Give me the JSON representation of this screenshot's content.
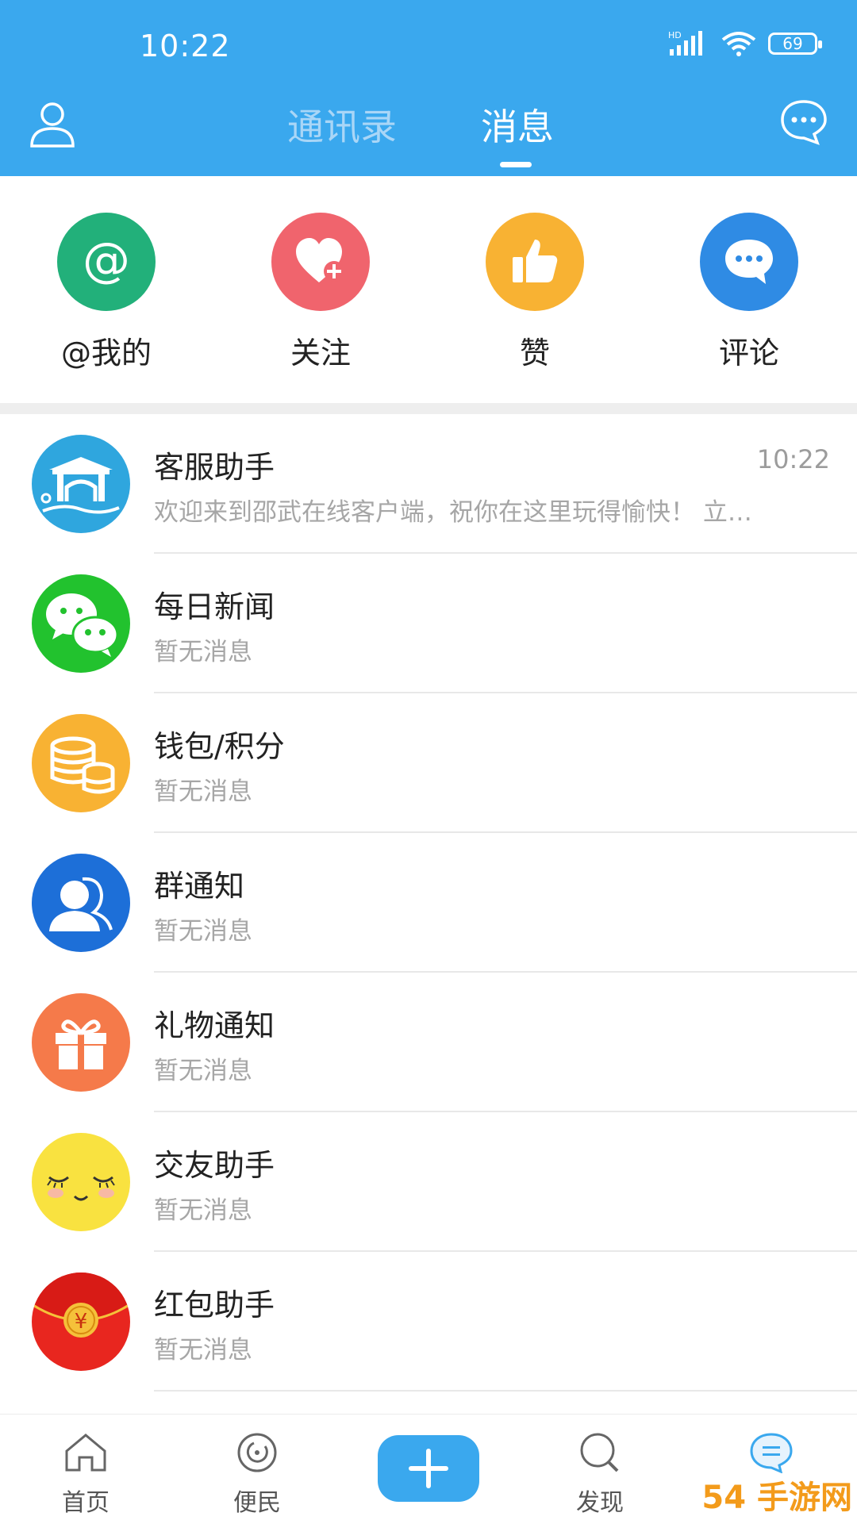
{
  "status": {
    "time": "10:22",
    "signal_tag": "HD",
    "battery": "69"
  },
  "header": {
    "tabs": [
      "通讯录",
      "消息"
    ]
  },
  "quick_actions": [
    {
      "label": "@我的",
      "icon": "at-icon",
      "color": "#22b07a"
    },
    {
      "label": "关注",
      "icon": "heart-plus-icon",
      "color": "#f0646d"
    },
    {
      "label": "赞",
      "icon": "thumbs-up-icon",
      "color": "#f8b233"
    },
    {
      "label": "评论",
      "icon": "comment-icon",
      "color": "#2f8be4"
    }
  ],
  "messages": [
    {
      "title": "客服助手",
      "preview": "欢迎来到邵武在线客户端，祝你在这里玩得愉快！ 立…",
      "time": "10:22",
      "icon": "gate-icon",
      "color": "#2fa6de"
    },
    {
      "title": "每日新闻",
      "preview": "暂无消息",
      "time": "",
      "icon": "wechat-icon",
      "color": "#22c22e"
    },
    {
      "title": "钱包/积分",
      "preview": "暂无消息",
      "time": "",
      "icon": "coins-icon",
      "color": "#f8b233"
    },
    {
      "title": "群通知",
      "preview": "暂无消息",
      "time": "",
      "icon": "group-icon",
      "color": "#1d6fd8"
    },
    {
      "title": "礼物通知",
      "preview": "暂无消息",
      "time": "",
      "icon": "gift-icon",
      "color": "#f57a4a"
    },
    {
      "title": "交友助手",
      "preview": "暂无消息",
      "time": "",
      "icon": "smile-face-icon",
      "color": "#f9e240"
    },
    {
      "title": "红包助手",
      "preview": "暂无消息",
      "time": "",
      "icon": "red-envelope-icon",
      "color": "#e8261f"
    }
  ],
  "bottom_nav": [
    {
      "label": "首页",
      "icon": "home-icon"
    },
    {
      "label": "便民",
      "icon": "service-icon"
    },
    {
      "label": "",
      "icon": "plus-icon"
    },
    {
      "label": "发现",
      "icon": "discover-icon"
    },
    {
      "label": "",
      "icon": "message-icon"
    }
  ],
  "watermark": "54 手游网"
}
